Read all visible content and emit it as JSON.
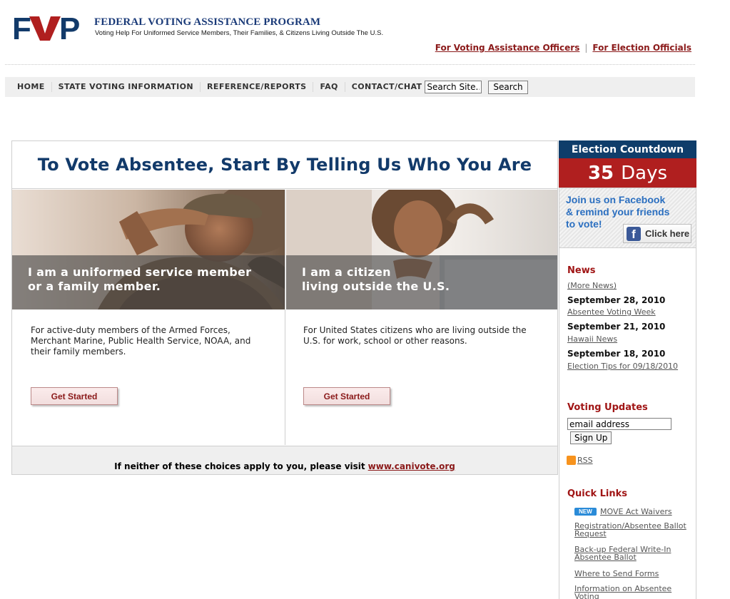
{
  "header": {
    "logo_text": "FVAP",
    "title": "FEDERAL VOTING ASSISTANCE PROGRAM",
    "subtitle": "Voting Help For Uniformed Service Members, Their Families, & Citizens Living Outside The U.S.",
    "links": [
      "For Voting Assistance Officers",
      "For Election Officials"
    ]
  },
  "nav": {
    "items": [
      "HOME",
      "STATE VOTING INFORMATION",
      "REFERENCE/REPORTS",
      "FAQ",
      "CONTACT/CHAT"
    ],
    "search_value": "Search Site...",
    "search_button": "Search"
  },
  "main": {
    "headline": "To Vote Absentee, Start By Telling Us Who You Are",
    "uniformed": {
      "caption_line1": "I am a uniformed service member",
      "caption_line2": "or a family member.",
      "description": "For active-duty members of the Armed Forces, Merchant Marine, Public Health Service, NOAA, and their family members.",
      "button": "Get Started"
    },
    "citizen": {
      "caption_line1": "I am a citizen",
      "caption_line2": "living outside the U.S.",
      "description": "For United States citizens who are living outside the U.S. for work, school or other reasons.",
      "button": "Get Started"
    },
    "footer_text": "If neither of these choices apply to you, please visit",
    "footer_link": "www.canivote.org"
  },
  "sidebar": {
    "countdown_title": "Election Countdown",
    "countdown_number": "35",
    "countdown_unit": "Days",
    "facebook_line1": "Join us on Facebook",
    "facebook_line2": "& remind your friends",
    "facebook_line3": "to vote!",
    "facebook_logo": "f",
    "facebook_button": "Click here",
    "news_title": "News",
    "more_news": "(More News)",
    "news": [
      {
        "date": "September 28, 2010",
        "title": "Absentee Voting Week"
      },
      {
        "date": "September 21, 2010",
        "title": "Hawaii News"
      },
      {
        "date": "September 18, 2010",
        "title": "Election Tips for 09/18/2010"
      }
    ],
    "updates_title": "Voting Updates",
    "email_value": "email address",
    "signup_button": "Sign Up",
    "rss_label": "RSS",
    "quick_links_title": "Quick Links",
    "new_badge": "NEW",
    "quick_links": [
      "MOVE Act Waivers",
      "Registration/Absentee Ballot Request",
      "Back-up Federal Write-In Absentee Ballot",
      "Where to Send Forms",
      "Information on Absentee Voting"
    ]
  },
  "colors": {
    "brand_blue": "#123a6a",
    "brand_red": "#b01f1f",
    "link_red": "#8b1a1a",
    "facebook_blue": "#2b6fc0"
  }
}
